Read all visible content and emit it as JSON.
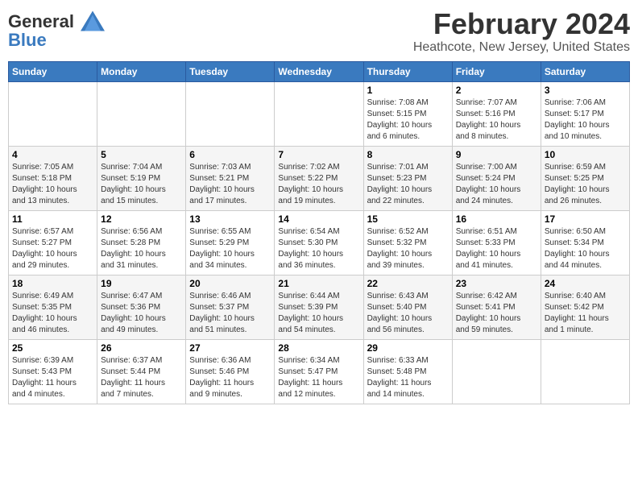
{
  "logo": {
    "text_general": "General",
    "text_blue": "Blue",
    "icon_color": "#3a7abf"
  },
  "header": {
    "title": "February 2024",
    "subtitle": "Heathcote, New Jersey, United States"
  },
  "weekdays": [
    "Sunday",
    "Monday",
    "Tuesday",
    "Wednesday",
    "Thursday",
    "Friday",
    "Saturday"
  ],
  "weeks": [
    [
      {
        "day": "",
        "info": ""
      },
      {
        "day": "",
        "info": ""
      },
      {
        "day": "",
        "info": ""
      },
      {
        "day": "",
        "info": ""
      },
      {
        "day": "1",
        "info": "Sunrise: 7:08 AM\nSunset: 5:15 PM\nDaylight: 10 hours\nand 6 minutes."
      },
      {
        "day": "2",
        "info": "Sunrise: 7:07 AM\nSunset: 5:16 PM\nDaylight: 10 hours\nand 8 minutes."
      },
      {
        "day": "3",
        "info": "Sunrise: 7:06 AM\nSunset: 5:17 PM\nDaylight: 10 hours\nand 10 minutes."
      }
    ],
    [
      {
        "day": "4",
        "info": "Sunrise: 7:05 AM\nSunset: 5:18 PM\nDaylight: 10 hours\nand 13 minutes."
      },
      {
        "day": "5",
        "info": "Sunrise: 7:04 AM\nSunset: 5:19 PM\nDaylight: 10 hours\nand 15 minutes."
      },
      {
        "day": "6",
        "info": "Sunrise: 7:03 AM\nSunset: 5:21 PM\nDaylight: 10 hours\nand 17 minutes."
      },
      {
        "day": "7",
        "info": "Sunrise: 7:02 AM\nSunset: 5:22 PM\nDaylight: 10 hours\nand 19 minutes."
      },
      {
        "day": "8",
        "info": "Sunrise: 7:01 AM\nSunset: 5:23 PM\nDaylight: 10 hours\nand 22 minutes."
      },
      {
        "day": "9",
        "info": "Sunrise: 7:00 AM\nSunset: 5:24 PM\nDaylight: 10 hours\nand 24 minutes."
      },
      {
        "day": "10",
        "info": "Sunrise: 6:59 AM\nSunset: 5:25 PM\nDaylight: 10 hours\nand 26 minutes."
      }
    ],
    [
      {
        "day": "11",
        "info": "Sunrise: 6:57 AM\nSunset: 5:27 PM\nDaylight: 10 hours\nand 29 minutes."
      },
      {
        "day": "12",
        "info": "Sunrise: 6:56 AM\nSunset: 5:28 PM\nDaylight: 10 hours\nand 31 minutes."
      },
      {
        "day": "13",
        "info": "Sunrise: 6:55 AM\nSunset: 5:29 PM\nDaylight: 10 hours\nand 34 minutes."
      },
      {
        "day": "14",
        "info": "Sunrise: 6:54 AM\nSunset: 5:30 PM\nDaylight: 10 hours\nand 36 minutes."
      },
      {
        "day": "15",
        "info": "Sunrise: 6:52 AM\nSunset: 5:32 PM\nDaylight: 10 hours\nand 39 minutes."
      },
      {
        "day": "16",
        "info": "Sunrise: 6:51 AM\nSunset: 5:33 PM\nDaylight: 10 hours\nand 41 minutes."
      },
      {
        "day": "17",
        "info": "Sunrise: 6:50 AM\nSunset: 5:34 PM\nDaylight: 10 hours\nand 44 minutes."
      }
    ],
    [
      {
        "day": "18",
        "info": "Sunrise: 6:49 AM\nSunset: 5:35 PM\nDaylight: 10 hours\nand 46 minutes."
      },
      {
        "day": "19",
        "info": "Sunrise: 6:47 AM\nSunset: 5:36 PM\nDaylight: 10 hours\nand 49 minutes."
      },
      {
        "day": "20",
        "info": "Sunrise: 6:46 AM\nSunset: 5:37 PM\nDaylight: 10 hours\nand 51 minutes."
      },
      {
        "day": "21",
        "info": "Sunrise: 6:44 AM\nSunset: 5:39 PM\nDaylight: 10 hours\nand 54 minutes."
      },
      {
        "day": "22",
        "info": "Sunrise: 6:43 AM\nSunset: 5:40 PM\nDaylight: 10 hours\nand 56 minutes."
      },
      {
        "day": "23",
        "info": "Sunrise: 6:42 AM\nSunset: 5:41 PM\nDaylight: 10 hours\nand 59 minutes."
      },
      {
        "day": "24",
        "info": "Sunrise: 6:40 AM\nSunset: 5:42 PM\nDaylight: 11 hours\nand 1 minute."
      }
    ],
    [
      {
        "day": "25",
        "info": "Sunrise: 6:39 AM\nSunset: 5:43 PM\nDaylight: 11 hours\nand 4 minutes."
      },
      {
        "day": "26",
        "info": "Sunrise: 6:37 AM\nSunset: 5:44 PM\nDaylight: 11 hours\nand 7 minutes."
      },
      {
        "day": "27",
        "info": "Sunrise: 6:36 AM\nSunset: 5:46 PM\nDaylight: 11 hours\nand 9 minutes."
      },
      {
        "day": "28",
        "info": "Sunrise: 6:34 AM\nSunset: 5:47 PM\nDaylight: 11 hours\nand 12 minutes."
      },
      {
        "day": "29",
        "info": "Sunrise: 6:33 AM\nSunset: 5:48 PM\nDaylight: 11 hours\nand 14 minutes."
      },
      {
        "day": "",
        "info": ""
      },
      {
        "day": "",
        "info": ""
      }
    ]
  ]
}
